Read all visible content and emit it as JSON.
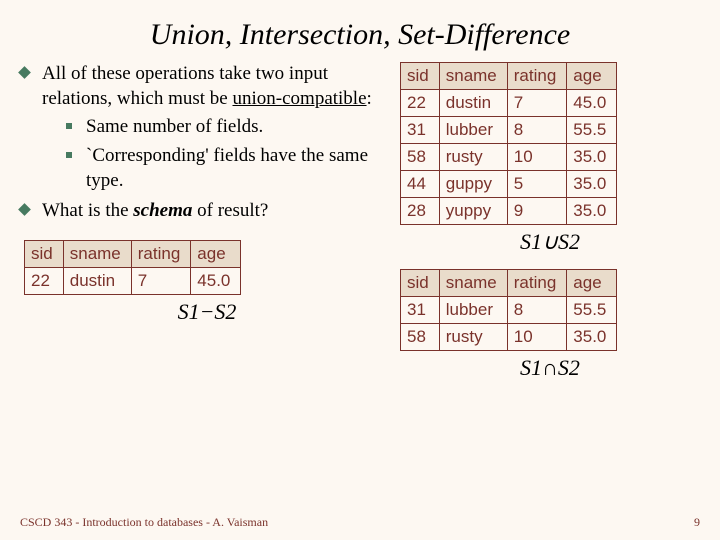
{
  "title": "Union, Intersection, Set-Difference",
  "bullets": {
    "b1": "All of these operations take two input relations, which must be ",
    "b1_uc": "union-compatible",
    "b1_end": ":",
    "s1": "Same number of fields.",
    "s2": "`Corresponding' fields have the same type.",
    "b2_a": "What is the ",
    "b2_b": "schema",
    "b2_c": " of result?"
  },
  "headers": {
    "sid": "sid",
    "sname": "sname",
    "rating": "rating",
    "age": "age"
  },
  "union_rows": [
    {
      "sid": "22",
      "sname": "dustin",
      "rating": "7",
      "age": "45.0"
    },
    {
      "sid": "31",
      "sname": "lubber",
      "rating": "8",
      "age": "55.5"
    },
    {
      "sid": "58",
      "sname": "rusty",
      "rating": "10",
      "age": "35.0"
    },
    {
      "sid": "44",
      "sname": "guppy",
      "rating": "5",
      "age": "35.0"
    },
    {
      "sid": "28",
      "sname": "yuppy",
      "rating": "9",
      "age": "35.0"
    }
  ],
  "inter_rows": [
    {
      "sid": "31",
      "sname": "lubber",
      "rating": "8",
      "age": "55.5"
    },
    {
      "sid": "58",
      "sname": "rusty",
      "rating": "10",
      "age": "35.0"
    }
  ],
  "diff_rows": [
    {
      "sid": "22",
      "sname": "dustin",
      "rating": "7",
      "age": "45.0"
    }
  ],
  "captions": {
    "union": "S1∪S2",
    "inter": "S1∩S2",
    "diff": "S1−S2"
  },
  "chart_data": {
    "type": "table",
    "tables": [
      {
        "label": "S1∪S2",
        "columns": [
          "sid",
          "sname",
          "rating",
          "age"
        ],
        "rows": [
          [
            22,
            "dustin",
            7,
            45.0
          ],
          [
            31,
            "lubber",
            8,
            55.5
          ],
          [
            58,
            "rusty",
            10,
            35.0
          ],
          [
            44,
            "guppy",
            5,
            35.0
          ],
          [
            28,
            "yuppy",
            9,
            35.0
          ]
        ]
      },
      {
        "label": "S1∩S2",
        "columns": [
          "sid",
          "sname",
          "rating",
          "age"
        ],
        "rows": [
          [
            31,
            "lubber",
            8,
            55.5
          ],
          [
            58,
            "rusty",
            10,
            35.0
          ]
        ]
      },
      {
        "label": "S1−S2",
        "columns": [
          "sid",
          "sname",
          "rating",
          "age"
        ],
        "rows": [
          [
            22,
            "dustin",
            7,
            45.0
          ]
        ]
      }
    ]
  },
  "footer": {
    "left": "CSCD 343 - Introduction to databases - A. Vaisman",
    "right": "9"
  }
}
